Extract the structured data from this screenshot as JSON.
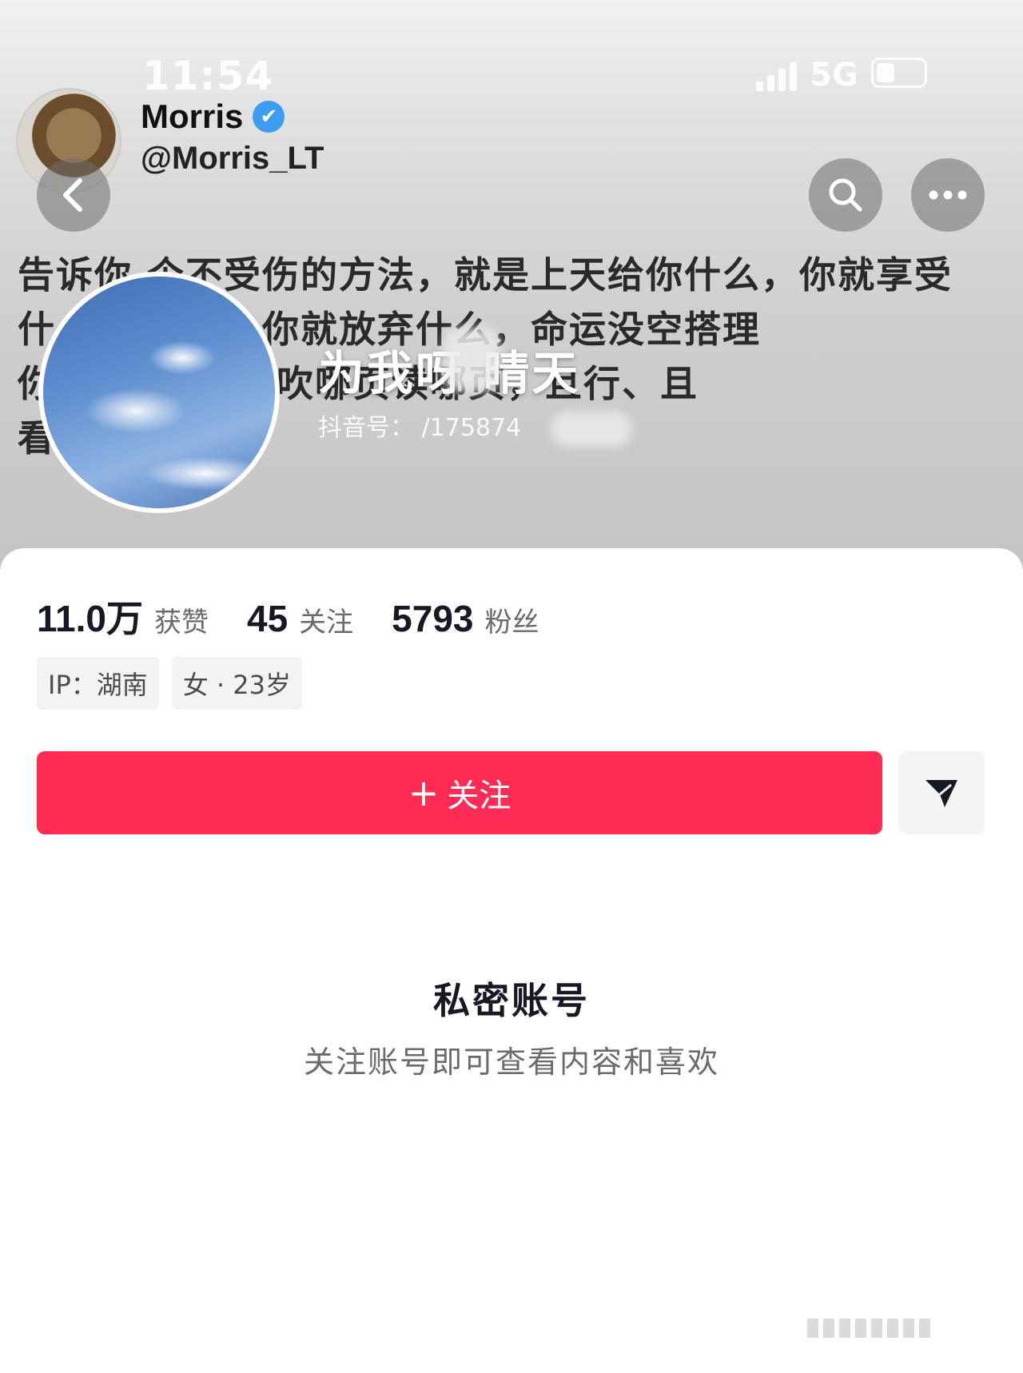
{
  "status_bar": {
    "time": "11:54",
    "network": "5G"
  },
  "poster": {
    "name": "Morris",
    "handle": "@Morris_LT",
    "verified_icon": "✔"
  },
  "profile": {
    "bio_lines": [
      "告诉你 个不受伤的方法，就是上天给你什么，你就享受",
      "什 走你什么，你就放弃什么，命运没空搭理",
      "你 你自己， 风吹哪页读哪页，且行、且",
      "看"
    ],
    "nickname": "为我呀 晴天",
    "douyin_id": "抖音号：  /175874"
  },
  "stats": [
    {
      "value": "11.0万",
      "label": "获赞"
    },
    {
      "value": "45",
      "label": "关注"
    },
    {
      "value": "5793",
      "label": "粉丝"
    }
  ],
  "tags": [
    "IP：湖南",
    "女 · 23岁"
  ],
  "follow_button": {
    "icon": "+",
    "label": "关注"
  },
  "private": {
    "title": "私密账号",
    "subtitle": "关注账号即可查看内容和喜欢"
  },
  "icons": {
    "back": "chevron-left-icon",
    "search": "search-icon",
    "more": "more-dots-icon",
    "share": "send-icon"
  },
  "colors": {
    "accent": "#fe2c55",
    "verified": "#3b9cf0"
  }
}
